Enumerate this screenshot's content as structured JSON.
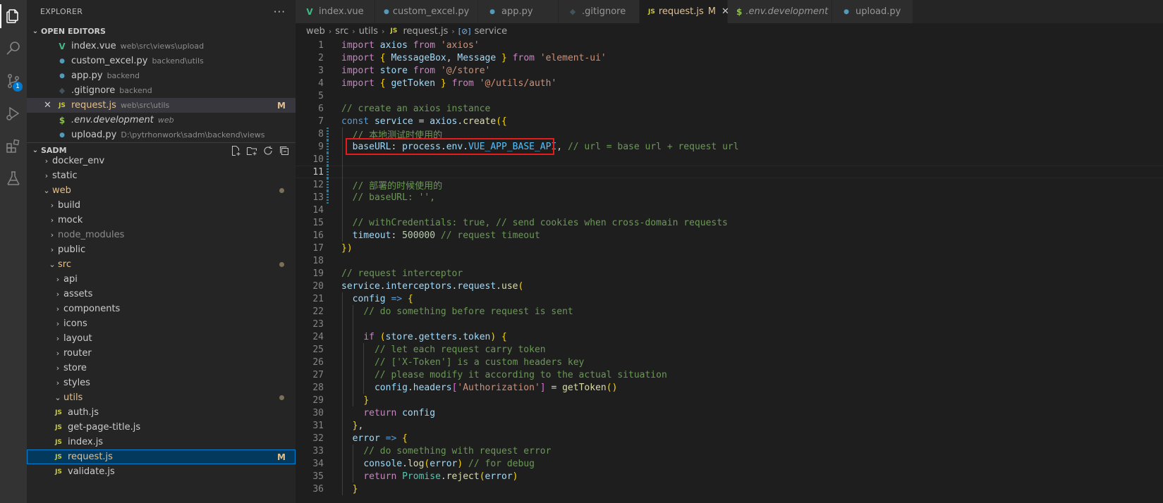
{
  "explorer": {
    "title": "EXPLORER",
    "more": "···",
    "open_editors_label": "OPEN EDITORS",
    "open_editors": [
      {
        "name": "index.vue",
        "path": "web\\src\\views\\upload",
        "icon": "vue-icon",
        "icon_glyph": "V"
      },
      {
        "name": "custom_excel.py",
        "path": "backend\\utils",
        "icon": "python-icon",
        "icon_glyph": "●"
      },
      {
        "name": "app.py",
        "path": "backend",
        "icon": "python-icon",
        "icon_glyph": "●"
      },
      {
        "name": ".gitignore",
        "path": "backend",
        "icon": "git-icon",
        "icon_glyph": "◆"
      },
      {
        "name": "request.js",
        "path": "web\\src\\utils",
        "icon": "js-icon",
        "icon_glyph": "JS",
        "modified": "M",
        "close": "✕"
      },
      {
        "name": ".env.development",
        "path": "web",
        "icon": "env-icon",
        "icon_glyph": "$"
      },
      {
        "name": "upload.py",
        "path": "D:\\pytrhonwork\\sadm\\backend\\views",
        "icon": "python-icon",
        "icon_glyph": "●"
      }
    ],
    "project_label": "SADM",
    "tree": [
      {
        "name": "docker_env",
        "caret": "›"
      },
      {
        "name": "static",
        "caret": "›"
      },
      {
        "name": "web",
        "caret": "⌄",
        "modified": true
      },
      {
        "name": "build",
        "caret": "›"
      },
      {
        "name": "mock",
        "caret": "›"
      },
      {
        "name": "node_modules",
        "caret": "›"
      },
      {
        "name": "public",
        "caret": "›"
      },
      {
        "name": "src",
        "caret": "⌄",
        "modified": true
      },
      {
        "name": "api",
        "caret": "›"
      },
      {
        "name": "assets",
        "caret": "›"
      },
      {
        "name": "components",
        "caret": "›"
      },
      {
        "name": "icons",
        "caret": "›"
      },
      {
        "name": "layout",
        "caret": "›"
      },
      {
        "name": "router",
        "caret": "›"
      },
      {
        "name": "store",
        "caret": "›"
      },
      {
        "name": "styles",
        "caret": "›"
      },
      {
        "name": "utils",
        "caret": "⌄",
        "modified": true
      },
      {
        "name": "auth.js",
        "icon_glyph": "JS"
      },
      {
        "name": "get-page-title.js",
        "icon_glyph": "JS"
      },
      {
        "name": "index.js",
        "icon_glyph": "JS"
      },
      {
        "name": "request.js",
        "icon_glyph": "JS",
        "modified": "M"
      },
      {
        "name": "validate.js",
        "icon_glyph": "JS"
      }
    ]
  },
  "tabs": [
    {
      "name": "index.vue",
      "icon_glyph": "V"
    },
    {
      "name": "custom_excel.py",
      "icon_glyph": "●"
    },
    {
      "name": "app.py",
      "icon_glyph": "●"
    },
    {
      "name": ".gitignore",
      "icon_glyph": "◆"
    },
    {
      "name": "request.js",
      "icon_glyph": "JS",
      "modified": "M",
      "close": "✕",
      "active": true
    },
    {
      "name": ".env.development",
      "icon_glyph": "$"
    },
    {
      "name": "upload.py",
      "icon_glyph": "●"
    }
  ],
  "breadcrumb": {
    "parts": [
      "web",
      "src",
      "utils",
      "request.js",
      "service"
    ],
    "sep": "›",
    "js_glyph": "JS",
    "symbol_glyph": "[⊘]"
  },
  "editor": {
    "current_line": 11,
    "lines": [
      "import axios from 'axios'",
      "import { MessageBox, Message } from 'element-ui'",
      "import store from '@/store'",
      "import { getToken } from '@/utils/auth'",
      "",
      "// create an axios instance",
      "const service = axios.create({",
      "  // 本地测试时使用的",
      "  baseURL: process.env.VUE_APP_BASE_API, // url = base url + request url",
      "",
      "",
      "  // 部署的时候使用的",
      "  // baseURL: '',",
      "",
      "  // withCredentials: true, // send cookies when cross-domain requests",
      "  timeout: 500000 // request timeout",
      "})",
      "",
      "// request interceptor",
      "service.interceptors.request.use(",
      "  config => {",
      "    // do something before request is sent",
      "",
      "    if (store.getters.token) {",
      "      // let each request carry token",
      "      // ['X-Token'] is a custom headers key",
      "      // please modify it according to the actual situation",
      "      config.headers['Authorization'] = getToken()",
      "    }",
      "    return config",
      "  },",
      "  error => {",
      "    // do something with request error",
      "    console.log(error) // for debug",
      "    return Promise.reject(error)",
      "  }"
    ]
  },
  "activity_bar": {
    "icons": [
      "files-icon",
      "search-icon",
      "source-control-icon",
      "run-debug-icon",
      "extensions-icon",
      "testing-icon"
    ],
    "scm_badge": "1"
  }
}
